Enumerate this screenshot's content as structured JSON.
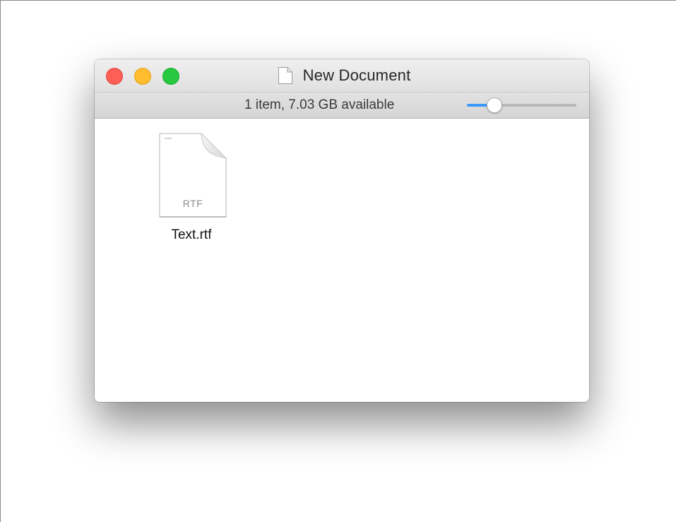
{
  "window": {
    "title": "New Document"
  },
  "statusbar": {
    "status_text": "1 item, 7.03 GB available",
    "icon_size_slider": {
      "value_fraction": 0.25
    }
  },
  "files": [
    {
      "name": "Text.rtf",
      "kind_label": "RTF",
      "icon": "rtf-document-icon"
    }
  ],
  "colors": {
    "close": "#fd5f57",
    "minimize": "#febc2e",
    "zoom": "#28c840",
    "slider_accent": "#3b99fc"
  }
}
